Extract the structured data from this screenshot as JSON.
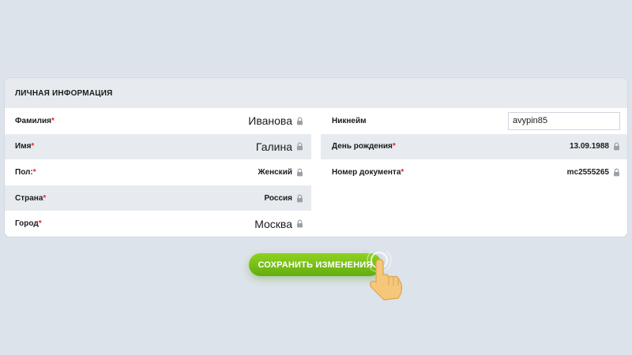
{
  "section_title": "ЛИЧНАЯ ИНФОРМАЦИЯ",
  "required_mark": "*",
  "left_fields": [
    {
      "label": "Фамилия",
      "value": "Иванова"
    },
    {
      "label": "Имя",
      "value": "Галина"
    },
    {
      "label": "Пол:",
      "value": "Женский"
    },
    {
      "label": "Страна",
      "value": "Россия"
    },
    {
      "label": "Город",
      "value": "Москва"
    }
  ],
  "right_fields": {
    "nickname": {
      "label": "Никнейм",
      "value": "avypin85"
    },
    "birthday": {
      "label": "День рождения",
      "value": "13.09.1988"
    },
    "document": {
      "label": "Номер документа",
      "value": "mc2555265"
    }
  },
  "save_button": "СОХРАНИТЬ ИЗМЕНЕНИЯ",
  "colors": {
    "background": "#dde3ea",
    "row_shade": "#e7ebf0",
    "required": "#e02525",
    "button": "#7cc21a"
  },
  "icons": {
    "field_lock": "lock-icon",
    "pointer": "pointing-hand-icon"
  }
}
